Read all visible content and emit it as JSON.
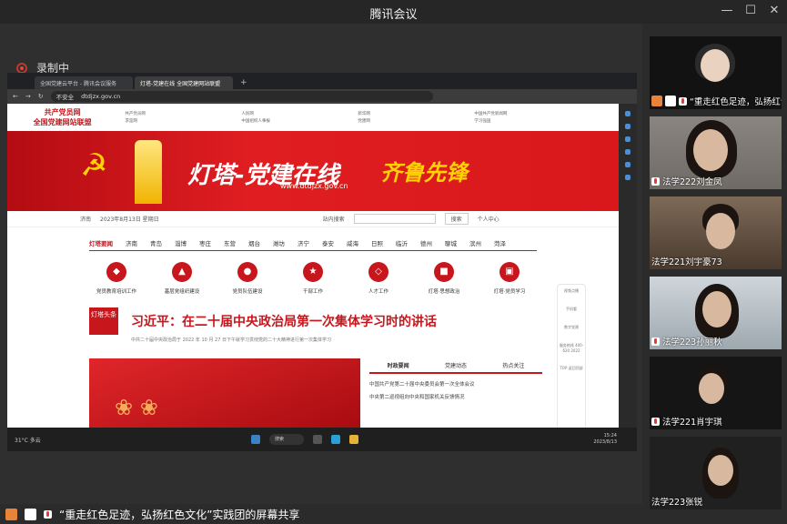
{
  "window": {
    "title": "腾讯会议",
    "minimize": "—",
    "maximize": "☐",
    "close": "✕"
  },
  "recording": {
    "label": "录制中"
  },
  "browser": {
    "tabs": [
      {
        "label": "全国党建云平台 - 腾讯会议服务"
      },
      {
        "label": "灯塔-党建在线 全国党建网站联盟"
      }
    ],
    "new_tab": "+",
    "address": "dtdjzx.gov.cn",
    "security": "不安全"
  },
  "site": {
    "logo_line1": "共产党员网",
    "logo_line2": "全国党建网站联盟",
    "head_links": [
      "共产党员网",
      "人民网",
      "新华网",
      "中国共产党新闻网",
      "求是网",
      "中国组织人事报",
      "党建网",
      "学习强国"
    ],
    "banner_title": "灯塔-党建在线",
    "banner_url": "www.dtdjzx.gov.cn",
    "banner_slogan": "齐鲁先锋",
    "info": {
      "location": "济南",
      "date": "2023年8月13日 星期日",
      "search_label": "站内搜索",
      "search_btn": "搜索",
      "login": "个人中心"
    },
    "nav": [
      "灯塔要闻",
      "济南",
      "青岛",
      "淄博",
      "枣庄",
      "东营",
      "烟台",
      "潍坊",
      "济宁",
      "泰安",
      "威海",
      "日照",
      "临沂",
      "德州",
      "聊城",
      "滨州",
      "菏泽"
    ],
    "features": [
      {
        "icon": "◆",
        "label": "党员教育培训工作"
      },
      {
        "icon": "▲",
        "label": "基层党组织建设"
      },
      {
        "icon": "●",
        "label": "党员队伍建设"
      },
      {
        "icon": "★",
        "label": "干部工作"
      },
      {
        "icon": "◇",
        "label": "人才工作"
      },
      {
        "icon": "■",
        "label": "灯塔·思想政治"
      },
      {
        "icon": "▣",
        "label": "灯塔·党员学习"
      }
    ],
    "hl_logo": "灯塔头条",
    "headline": "习近平：在二十届中央政治局第一次集体学习时的讲话",
    "sub_headline": "中共二十届中央政治局于 2022 年 10 月 27 日下午就学习贯彻党的二十大精神进行第一次集体学习",
    "news_tabs": [
      "时政要闻",
      "党建动态",
      "热点关注"
    ],
    "news": [
      "中国共产党第二十届中央委员会第一次全体会议",
      "中央第二巡视组向中央和国家机关反馈情况"
    ],
    "float_items": [
      "视频点播",
      "手机看",
      "数字党建",
      "服务热线 400-620 2022",
      "TOP 返回顶部"
    ]
  },
  "taskbar": {
    "weather": "31°C 多云",
    "search": "搜索",
    "time": "15:24",
    "date": "2023/8/13"
  },
  "share_bar": {
    "label": "“重走红色足迹，弘扬红色文化”实践团的屏幕共享"
  },
  "participants": [
    {
      "name": "“重走红色足迹，弘扬红色文化”实践团"
    },
    {
      "name": "法学222刘金凤"
    },
    {
      "name": "法学221刘宇豪73"
    },
    {
      "name": "法学223孙丽秋"
    },
    {
      "name": "法学221肖宇琪"
    },
    {
      "name": "法学223张锐"
    }
  ],
  "colors": {
    "accent": "#c8161d",
    "bg": "#2b2b2b"
  }
}
